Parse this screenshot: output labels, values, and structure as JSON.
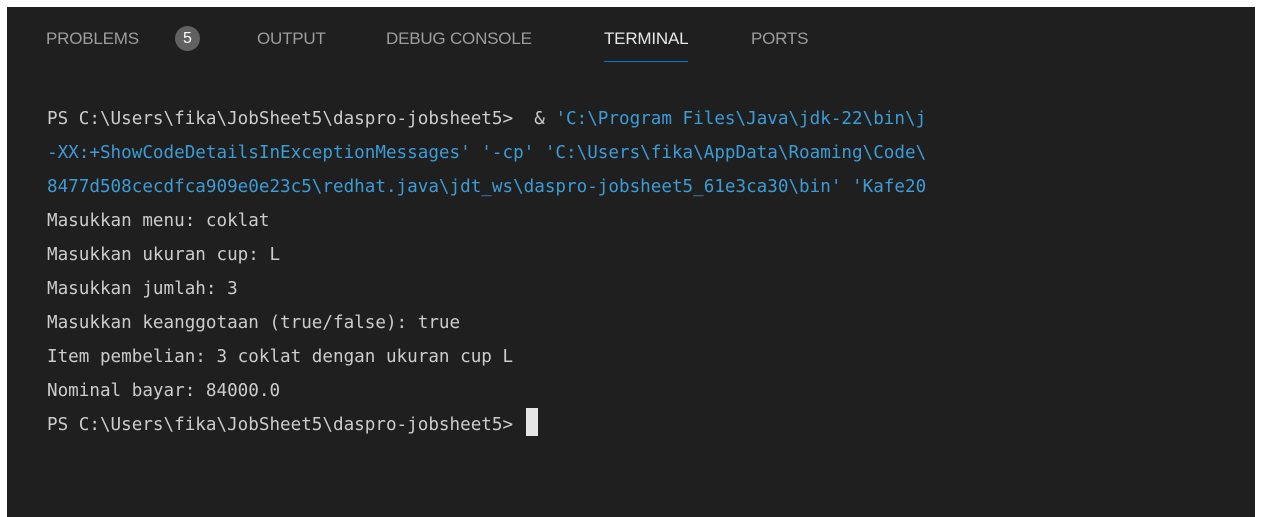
{
  "tabs": [
    {
      "label": "PROBLEMS",
      "badge": "5"
    },
    {
      "label": "OUTPUT"
    },
    {
      "label": "DEBUG CONSOLE"
    },
    {
      "label": "TERMINAL",
      "active": true
    },
    {
      "label": "PORTS"
    }
  ],
  "terminal": {
    "line1_prompt": "PS C:\\Users\\fika\\JobSheet5\\daspro-jobsheet5>  & ",
    "line1_cmd": "'C:\\Program Files\\Java\\jdk-22\\bin\\j",
    "line2": "-XX:+ShowCodeDetailsInExceptionMessages' '-cp' 'C:\\Users\\fika\\AppData\\Roaming\\Code\\",
    "line3": "8477d508cecdfca909e0e23c5\\redhat.java\\jdt_ws\\daspro-jobsheet5_61e3ca30\\bin' 'Kafe20",
    "output": [
      "Masukkan menu: coklat",
      "Masukkan ukuran cup: L",
      "Masukkan jumlah: 3",
      "Masukkan keanggotaan (true/false): true",
      "Item pembelian: 3 coklat dengan ukuran cup L",
      "Nominal bayar: 84000.0"
    ],
    "final_prompt": "PS C:\\Users\\fika\\JobSheet5\\daspro-jobsheet5> "
  },
  "colors": {
    "background": "#1f1f1f",
    "text": "#cccccc",
    "string": "#3b9cd6",
    "accent": "#0078d4"
  }
}
